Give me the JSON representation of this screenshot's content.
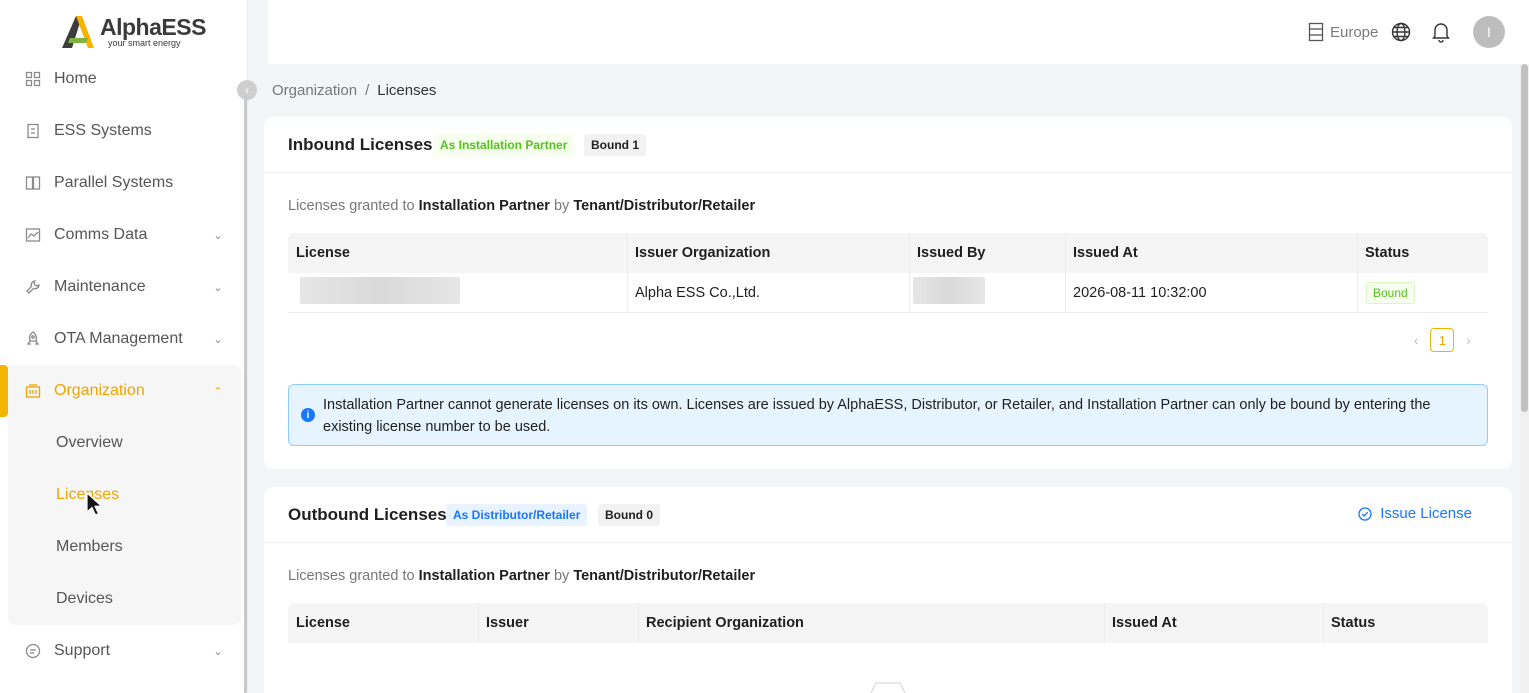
{
  "logo": {
    "name": "AlphaESS",
    "tagline": "your smart energy"
  },
  "sidebar": {
    "items": [
      {
        "label": "Home",
        "icon": "home-icon"
      },
      {
        "label": "ESS Systems",
        "icon": "ess-icon"
      },
      {
        "label": "Parallel Systems",
        "icon": "parallel-icon"
      },
      {
        "label": "Comms Data",
        "icon": "chart-icon"
      },
      {
        "label": "Maintenance",
        "icon": "wrench-icon"
      },
      {
        "label": "OTA Management",
        "icon": "rocket-icon"
      },
      {
        "label": "Organization",
        "icon": "building-icon"
      },
      {
        "label": "Support",
        "icon": "chat-icon"
      }
    ],
    "organization_sub": [
      "Overview",
      "Licenses",
      "Members",
      "Devices"
    ],
    "active_color": "#f0a500"
  },
  "header": {
    "region": "Europe",
    "avatar_initial": "I"
  },
  "breadcrumb": {
    "parent": "Organization",
    "separator": "/",
    "current": "Licenses"
  },
  "inbound": {
    "title": "Inbound Licenses",
    "role_tag": "As Installation Partner",
    "count_tag": "Bound 1",
    "desc_prefix": "Licenses granted to",
    "desc_recipient": "Installation Partner",
    "desc_by": "by",
    "desc_issuer": "Tenant/Distributor/Retailer",
    "columns": [
      "License",
      "Issuer Organization",
      "Issued By",
      "Issued At",
      "Status"
    ],
    "rows": [
      {
        "license": "",
        "issuer_org": "Alpha ESS Co.,Ltd.",
        "issued_by": "",
        "issued_at": "2026-08-11 10:32:00",
        "status": "Bound"
      }
    ],
    "page": "1",
    "alert": "Installation Partner cannot generate licenses on its own. Licenses are issued by AlphaESS, Distributor, or Retailer, and Installation Partner can only be bound by entering the existing license number to be used."
  },
  "outbound": {
    "title": "Outbound Licenses",
    "role_tag": "As Distributor/Retailer",
    "count_tag": "Bound 0",
    "action": "Issue License",
    "desc_prefix": "Licenses granted to",
    "desc_recipient": "Installation Partner",
    "desc_by": "by",
    "desc_issuer": "Tenant/Distributor/Retailer",
    "columns": [
      "License",
      "Issuer",
      "Recipient Organization",
      "Issued At",
      "Status"
    ]
  }
}
